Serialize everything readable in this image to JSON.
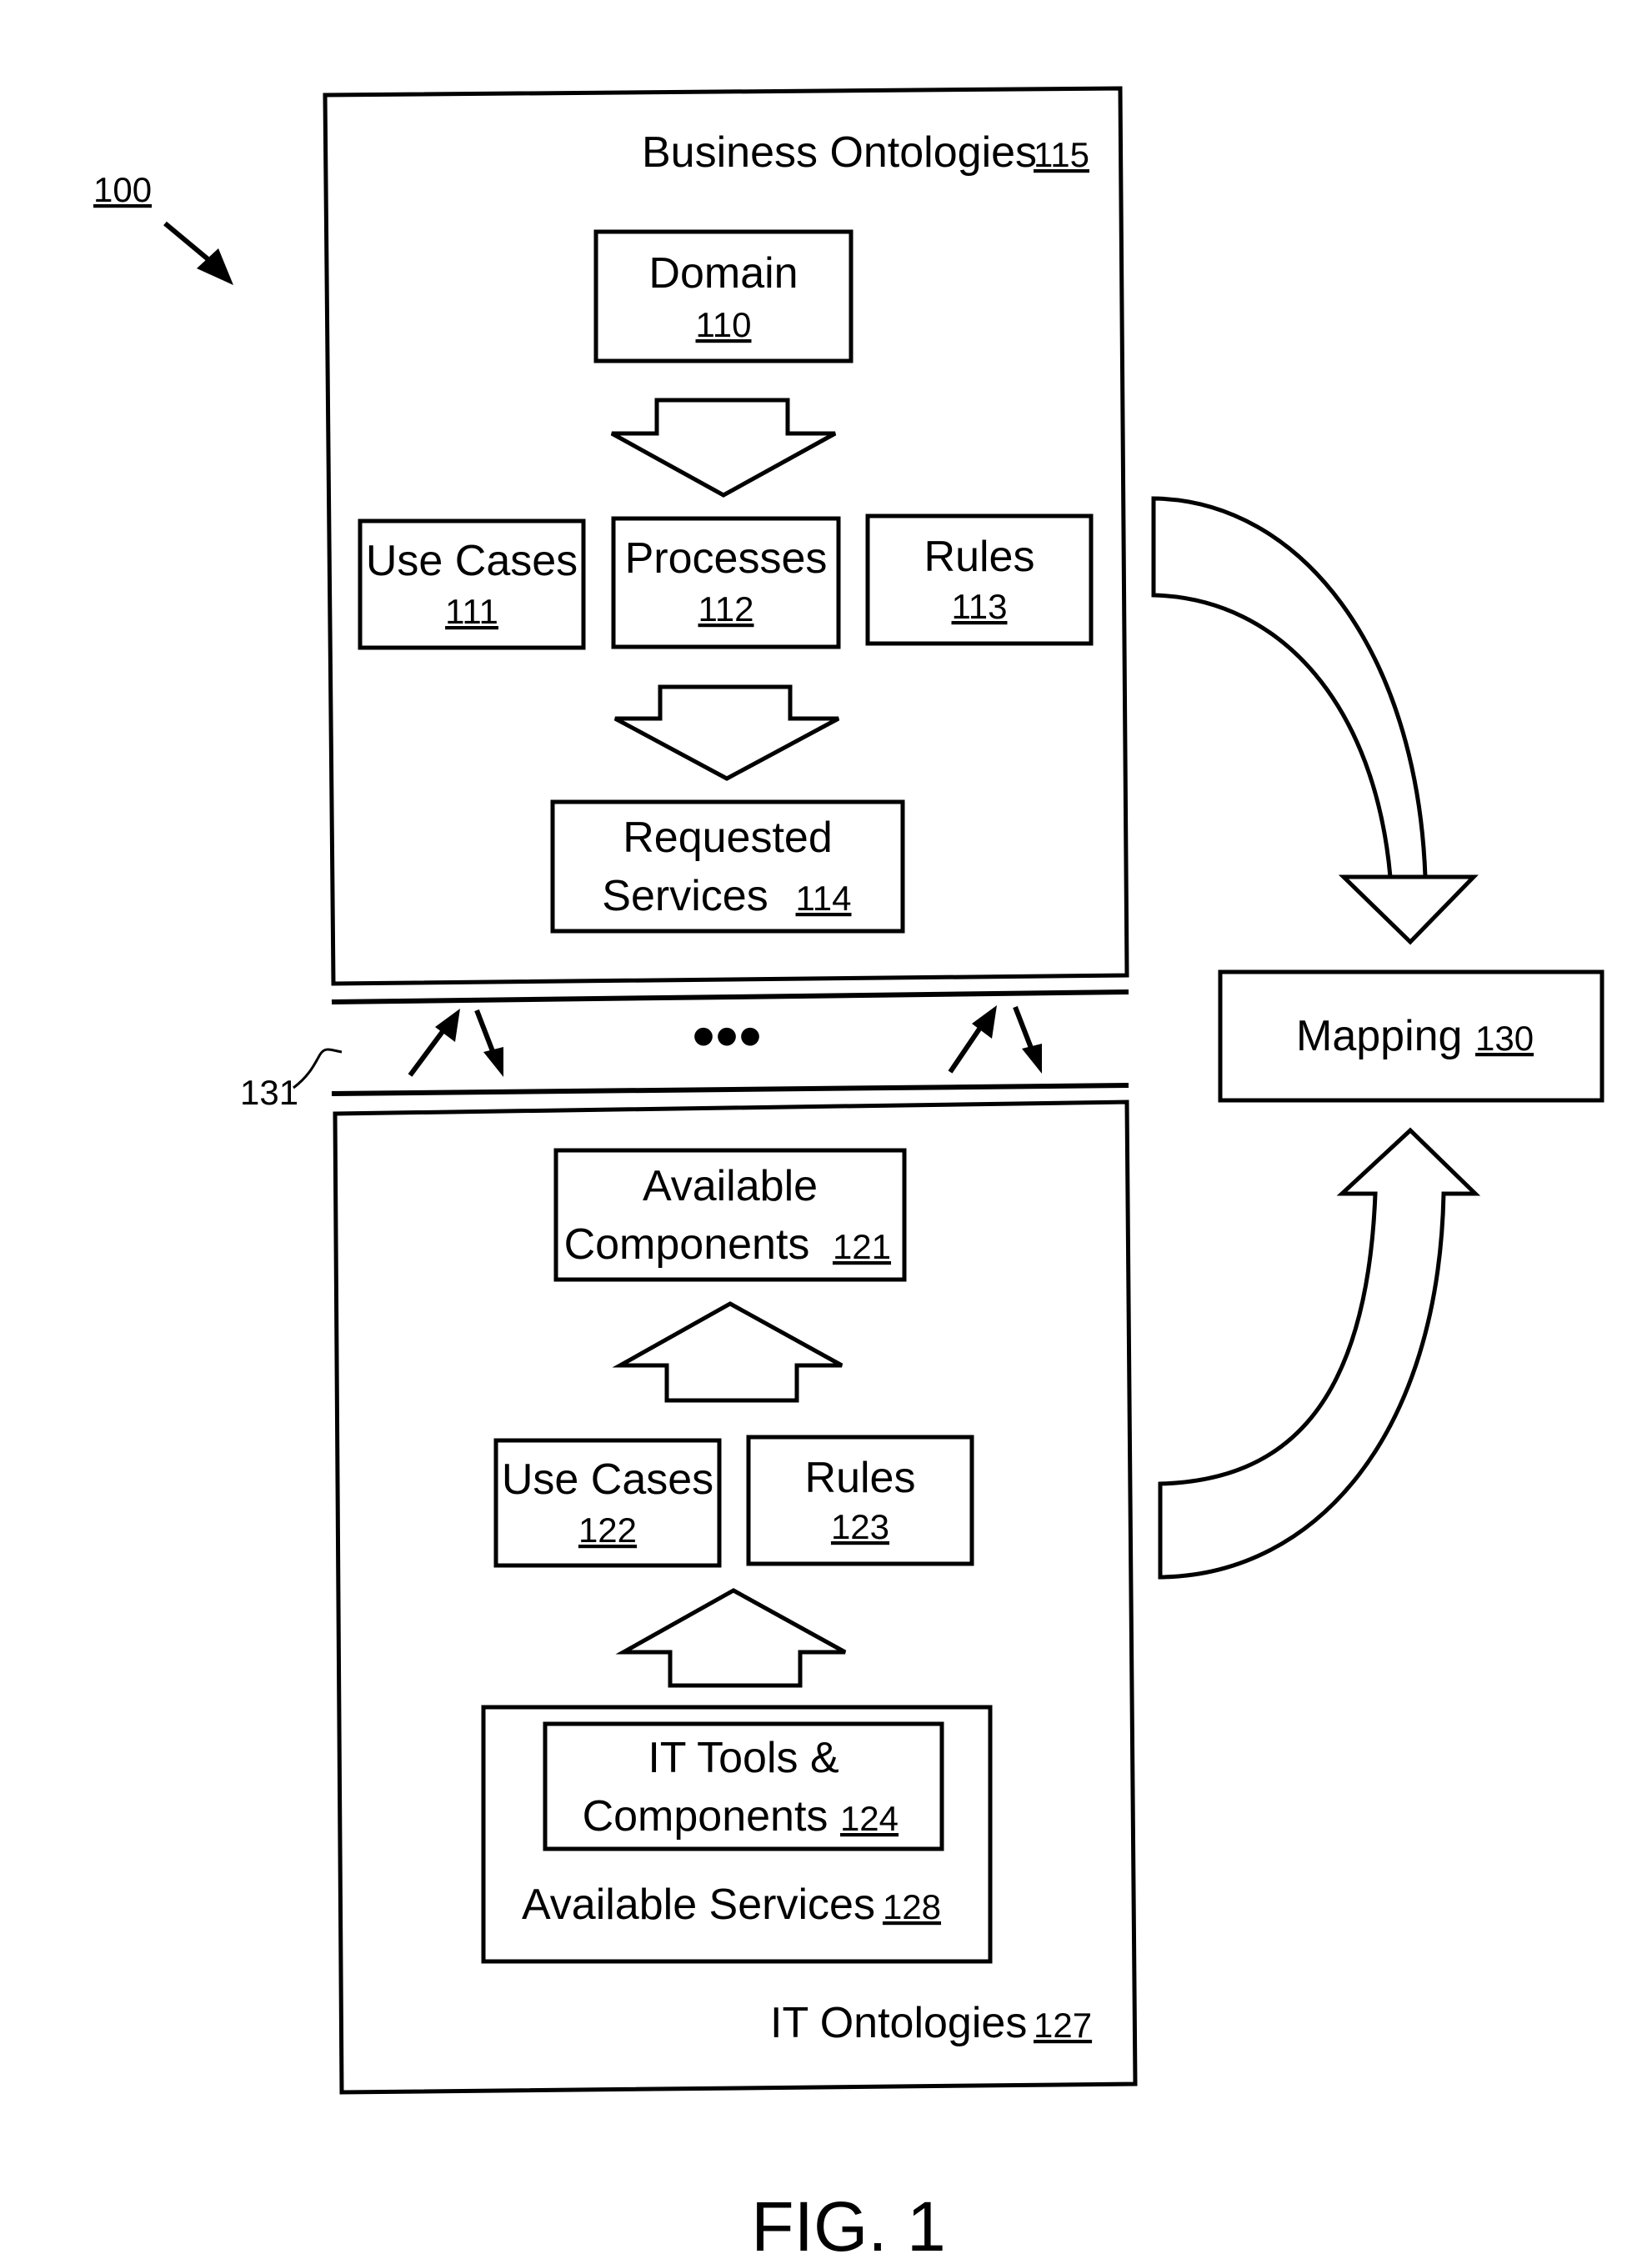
{
  "figure": {
    "ref": "100",
    "caption": "FIG. 1"
  },
  "business_ontologies": {
    "title": "Business Ontologies",
    "ref": "115",
    "domain": {
      "label": "Domain",
      "ref": "110"
    },
    "use_cases": {
      "label": "Use Cases",
      "ref": "111"
    },
    "processes": {
      "label": "Processes",
      "ref": "112"
    },
    "rules": {
      "label": "Rules",
      "ref": "113"
    },
    "requested_services": {
      "line1": "Requested",
      "line2": "Services",
      "ref": "114"
    }
  },
  "interface": {
    "ref": "131",
    "ellipsis": "•••"
  },
  "it_ontologies": {
    "title": "IT Ontologies",
    "ref": "127",
    "available_components": {
      "line1": "Available",
      "line2": "Components",
      "ref": "121"
    },
    "use_cases": {
      "label": "Use Cases",
      "ref": "122"
    },
    "rules": {
      "label": "Rules",
      "ref": "123"
    },
    "it_tools": {
      "line1": "IT Tools &",
      "line2": "Components",
      "ref": "124"
    },
    "available_services": {
      "label": "Available Services",
      "ref": "128"
    }
  },
  "mapping": {
    "label": "Mapping",
    "ref": "130"
  }
}
